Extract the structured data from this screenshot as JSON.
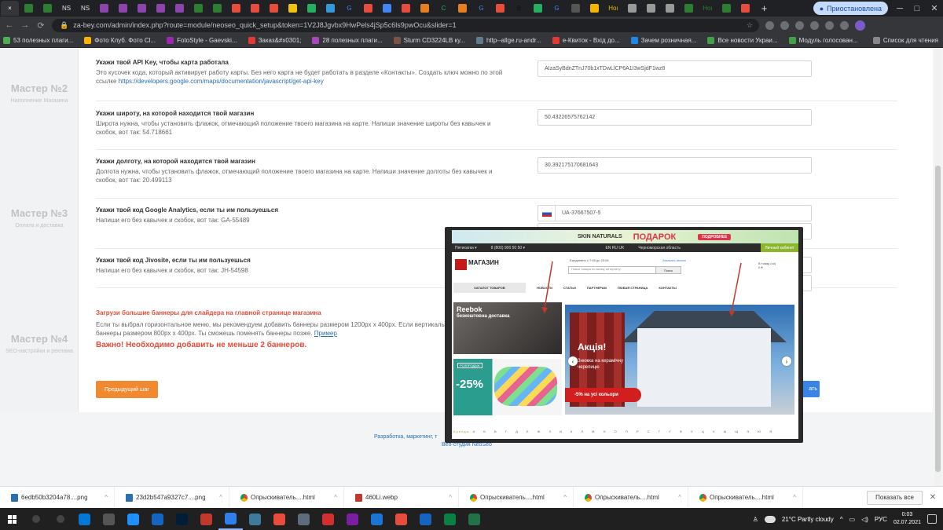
{
  "browser": {
    "tabs": [
      {
        "label": "×",
        "color": "#ffffff",
        "active": true
      },
      {
        "label": "",
        "color": "#2e7d32"
      },
      {
        "label": "",
        "color": "#2e7d32"
      },
      {
        "label": "NS",
        "color": "#e0e0e0"
      },
      {
        "label": "NS",
        "color": "#e0e0e0"
      },
      {
        "label": "",
        "color": "#8e44ad"
      },
      {
        "label": "",
        "color": "#8e44ad"
      },
      {
        "label": "",
        "color": "#8e44ad"
      },
      {
        "label": "",
        "color": "#8e44ad"
      },
      {
        "label": "",
        "color": "#8e44ad"
      },
      {
        "label": "",
        "color": "#2e7d32"
      },
      {
        "label": "",
        "color": "#2e7d32"
      },
      {
        "label": "",
        "color": "#e74c3c"
      },
      {
        "label": "",
        "color": "#e74c3c"
      },
      {
        "label": "",
        "color": "#e74c3c"
      },
      {
        "label": "",
        "color": "#f1c40f"
      },
      {
        "label": "",
        "color": "#27ae60"
      },
      {
        "label": "",
        "color": "#3498db"
      },
      {
        "label": "G",
        "color": "#4285f4"
      },
      {
        "label": "",
        "color": "#e74c3c"
      },
      {
        "label": "",
        "color": "#4285f4"
      },
      {
        "label": "",
        "color": "#e74c3c"
      },
      {
        "label": "",
        "color": "#e67e22"
      },
      {
        "label": "C",
        "color": "#27ae60"
      },
      {
        "label": "",
        "color": "#e67e22"
      },
      {
        "label": "G",
        "color": "#4285f4"
      },
      {
        "label": "",
        "color": "#e74c3c"
      },
      {
        "label": "B",
        "color": "#111111"
      },
      {
        "label": "",
        "color": "#27ae60"
      },
      {
        "label": "G",
        "color": "#4285f4"
      },
      {
        "label": "",
        "color": "#555555"
      },
      {
        "label": "",
        "color": "#f4b400"
      },
      {
        "label": "Ноı",
        "color": "#f4b400"
      },
      {
        "label": "",
        "color": "#999999"
      },
      {
        "label": "",
        "color": "#999999"
      },
      {
        "label": "",
        "color": "#999999"
      },
      {
        "label": "",
        "color": "#2e7d32"
      },
      {
        "label": "Ноı",
        "color": "#2e7d32"
      },
      {
        "label": "",
        "color": "#2e7d32"
      },
      {
        "label": "",
        "color": "#e74c3c"
      }
    ],
    "new_tab": "+",
    "paused_label": "Приостановлена",
    "window_controls": [
      "─",
      "□",
      "✕"
    ],
    "url": "za-bey.com/admin/index.php?route=module/neoseo_quick_setup&token=1V2J8Jgvbx9HwPels4jSp5c6ls9pwOcu&slider=1",
    "bookmarks": [
      "53 полезных плаги...",
      "Фото Клуб. Фото Cl...",
      "FotoStyle - Gaevski...",
      "Заказ&#x0301;",
      "28 полезных плаги...",
      "Sturm CD3224LB ку...",
      "http--allge.ru-andr...",
      "e-Квиток - Вхід до...",
      "Зачем розничная...",
      "Все новости Украи...",
      "Модуль голосован..."
    ],
    "bookmarks_right": "Список для чтения"
  },
  "sidebar": {
    "steps": [
      {
        "title": "Мастер №2",
        "sub": "Наполнение Магазина"
      },
      {
        "title": "Мастер №3",
        "sub": "Оплата и доставка"
      },
      {
        "title": "Мастер №4",
        "sub": "SEO-настройки и реклама"
      }
    ]
  },
  "form": {
    "api_key": {
      "label": "Укажи твой API Key, чтобы карта работала",
      "desc": "Это кусочек кода, который активирует работу карты. Без него карта не будет работать в разделе «Контакты». Создать ключ можно по этой ссылке ",
      "link": "https://developers.google.com/maps/documentation/javascript/get-api-key",
      "value": "AIzaSyBdnZTnJ70b1xTDwLlCP6A1I3wSjdF1wz8"
    },
    "latitude": {
      "label": "Укажи широту, на которой находится твой магазин",
      "desc": "Широта нужна, чтобы установить флажок, отмечающий положение твоего магазина на карте. Напиши значение широты без кавычек и скобок, вот так: 54.718661",
      "value": "50.43226575762142"
    },
    "longitude": {
      "label": "Укажи долготу, на которой находится твой магазин",
      "desc": "Долгота нужна, чтобы установить флажок, отмечающий положение твоего магазина на карте. Напиши значение долготы без кавычек и скобок, вот так: 20.499113",
      "value": "30.392175170681643"
    },
    "analytics": {
      "label": "Укажи твой код Google Analytics, если ты им пользуешься",
      "desc": "Напиши его без кавычек и скобок, вот так: GA-55489",
      "value": "UA-37667507-5"
    },
    "jivosite": {
      "label": "Укажи твой код Jivosite, если ты им пользуешься",
      "desc": "Напиши его без кавычек и скобок, вот так: JH-54598"
    },
    "banners": {
      "title": "Загрузи большие баннеры для слайдера на главной странице магазина",
      "desc": "Если ты выбрал горизонтальное меню, мы рекомендуем добавить баннеры размером 1200px x 400px. Если вертикальное меню — баннеры размером 800px x 400px. Ты сможешь поменять баннеры позже. ",
      "example_link": "Пример",
      "important": "Важно! Необходимо добавить не меньше 2 баннеров."
    },
    "prev_button": "Предыдущий шаг",
    "next_button": "ать"
  },
  "footer": {
    "line1": "Разработка, маркетинг, т",
    "line2": "Веб-студия NeoSeo"
  },
  "preview": {
    "promo_brand": "SKIN NATURALS",
    "promo_gift": "ПОДАРОК",
    "promo_button": "ПОДРОБНЕЕ",
    "nav_location": "Пятихатки ▾",
    "nav_phone": "8 (800) 900 50 50 ▾",
    "nav_langs": "EN RU UK",
    "nav_region": "Черноморская область",
    "nav_account": "Личный кабинет",
    "logo_text": "МАГАЗИН",
    "schedule": "Ежедневно с 7:55 до 20:05",
    "callback": "Заказать звонок",
    "search_placeholder": "Поиск товара по всему интернету",
    "search_button": "Поиск",
    "cart": "В товар (со)",
    "cart_sum": "0 ₴",
    "menu": [
      "КАТАЛОГ ТОВАРОВ",
      "НОВОСТИ",
      "СТАТЬИ",
      "ПАРТНЕРАМ",
      "ЛЮБАЯ СТРАНИЦА",
      "КОНТАКТЫ"
    ],
    "banner1_brand": "Reebok",
    "banner1_text": "безкоштовна доставка",
    "banner2_tag": "РОЗПРОДАЖ",
    "banner2_pct": "-25%",
    "slider_title": "Акція!",
    "slider_text": "Знижка на керамічну черепицю",
    "slider_discount": "-5% на усі кольори",
    "alpha_label": "Бренды",
    "alphabet": "А Б В Г Д Е Ж З И К Л М Н О П Р С Т У Ф Х Ц Ч Ш Щ Э Ю Я"
  },
  "downloads": [
    {
      "name": "6edb50b3204a78....png",
      "icon": "file"
    },
    {
      "name": "23d2b547a9327c7....png",
      "icon": "file"
    },
    {
      "name": "Опрыскиватель....html",
      "icon": "chrome"
    },
    {
      "name": "460Li.webp",
      "icon": "red"
    },
    {
      "name": "Опрыскиватель....html",
      "icon": "chrome"
    },
    {
      "name": "Опрыскиватель....html",
      "icon": "chrome"
    },
    {
      "name": "Опрыскиватель....html",
      "icon": "chrome"
    }
  ],
  "show_all": "Показать все",
  "taskbar": {
    "apps": [
      "#0078d4",
      "#555555",
      "#1e90ff",
      "#1565c0",
      "#001e36",
      "#c0392b",
      "#2f80ed",
      "#3d7a9b",
      "#e74c3c",
      "#5d6d7e",
      "#d32f2f",
      "#7b1fa2",
      "#1976d2",
      "#e74c3c",
      "#1565c0",
      "#0b8043",
      "#217346"
    ],
    "weather": "21°C  Partly cloudy",
    "lang": "РУС",
    "time": "0:03",
    "date": "02.07.2021"
  }
}
